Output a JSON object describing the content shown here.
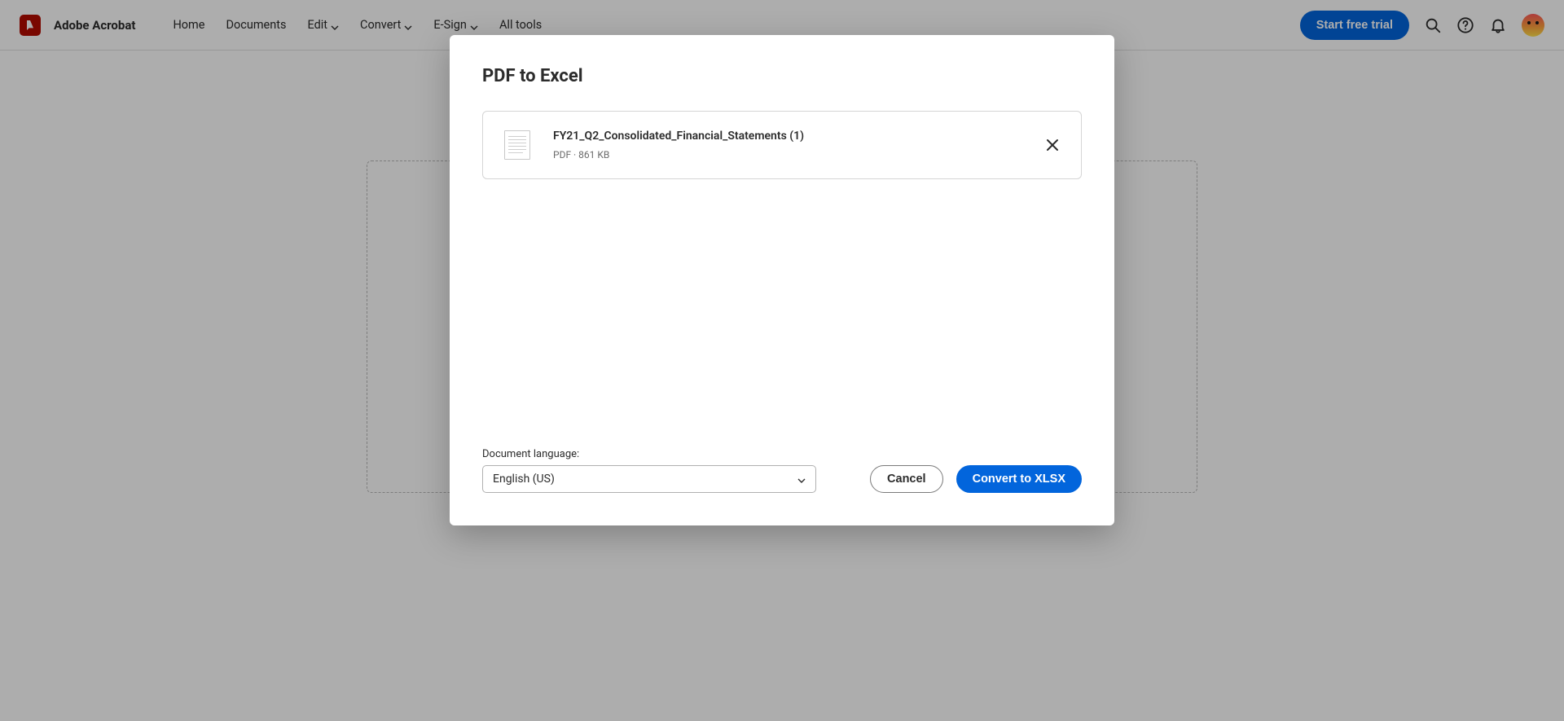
{
  "app": {
    "name": "Adobe Acrobat"
  },
  "nav": {
    "home": "Home",
    "documents": "Documents",
    "edit": "Edit",
    "convert": "Convert",
    "esign": "E-Sign",
    "all_tools": "All tools"
  },
  "header": {
    "trial_button": "Start free trial"
  },
  "modal": {
    "title": "PDF to Excel",
    "file": {
      "name": "FY21_Q2_Consolidated_Financial_Statements (1)",
      "type": "PDF",
      "size": "861 KB",
      "separator": " · "
    },
    "language_label": "Document language:",
    "language_value": "English (US)",
    "cancel": "Cancel",
    "convert": "Convert to XLSX"
  }
}
